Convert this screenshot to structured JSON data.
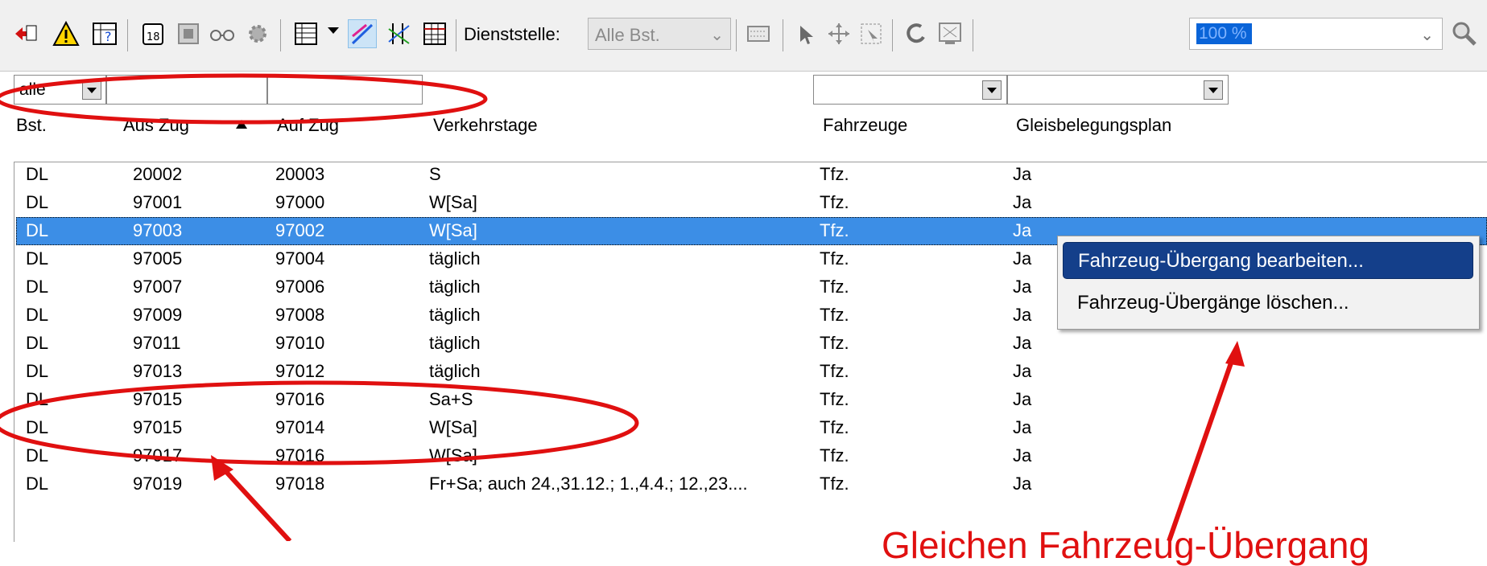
{
  "toolbar": {
    "dienststelle_label": "Dienststelle:",
    "dienststelle_value": "Alle Bst.",
    "zoom_value": "100 %"
  },
  "filter": {
    "bst_value": "alle"
  },
  "columns": {
    "bst": "Bst.",
    "aus_zug": "Aus Zug",
    "auf_zug": "Auf Zug",
    "verkehrstage": "Verkehrstage",
    "fahrzeuge": "Fahrzeuge",
    "gleisbelegungsplan": "Gleisbelegungsplan"
  },
  "rows": [
    {
      "bst": "DL",
      "aus": "20002",
      "auf": "20003",
      "tage": "S",
      "fz": "Tfz.",
      "gbp": "Ja"
    },
    {
      "bst": "DL",
      "aus": "97001",
      "auf": "97000",
      "tage": "W[Sa]",
      "fz": "Tfz.",
      "gbp": "Ja"
    },
    {
      "bst": "DL",
      "aus": "97003",
      "auf": "97002",
      "tage": "W[Sa]",
      "fz": "Tfz.",
      "gbp": "Ja"
    },
    {
      "bst": "DL",
      "aus": "97005",
      "auf": "97004",
      "tage": "täglich",
      "fz": "Tfz.",
      "gbp": "Ja"
    },
    {
      "bst": "DL",
      "aus": "97007",
      "auf": "97006",
      "tage": "täglich",
      "fz": "Tfz.",
      "gbp": "Ja"
    },
    {
      "bst": "DL",
      "aus": "97009",
      "auf": "97008",
      "tage": "täglich",
      "fz": "Tfz.",
      "gbp": "Ja"
    },
    {
      "bst": "DL",
      "aus": "97011",
      "auf": "97010",
      "tage": "täglich",
      "fz": "Tfz.",
      "gbp": "Ja"
    },
    {
      "bst": "DL",
      "aus": "97013",
      "auf": "97012",
      "tage": "täglich",
      "fz": "Tfz.",
      "gbp": "Ja"
    },
    {
      "bst": "DL",
      "aus": "97015",
      "auf": "97016",
      "tage": "Sa+S",
      "fz": "Tfz.",
      "gbp": "Ja"
    },
    {
      "bst": "DL",
      "aus": "97015",
      "auf": "97014",
      "tage": "W[Sa]",
      "fz": "Tfz.",
      "gbp": "Ja"
    },
    {
      "bst": "DL",
      "aus": "97017",
      "auf": "97016",
      "tage": "W[Sa]",
      "fz": "Tfz.",
      "gbp": "Ja"
    },
    {
      "bst": "DL",
      "aus": "97019",
      "auf": "97018",
      "tage": "Fr+Sa; auch 24.,31.12.; 1.,4.4.; 12.,23....",
      "fz": "Tfz.",
      "gbp": "Ja"
    }
  ],
  "context_menu": {
    "items": [
      "Fahrzeug-Übergang bearbeiten...",
      "Fahrzeug-Übergänge löschen..."
    ]
  },
  "annotation": {
    "text": "Gleichen Fahrzeug-Übergang",
    "color": "#e01010"
  },
  "colors": {
    "selection": "#3c8ee6",
    "menu_highlight": "#143f8a",
    "zoom_highlight": "#0a64d8"
  }
}
